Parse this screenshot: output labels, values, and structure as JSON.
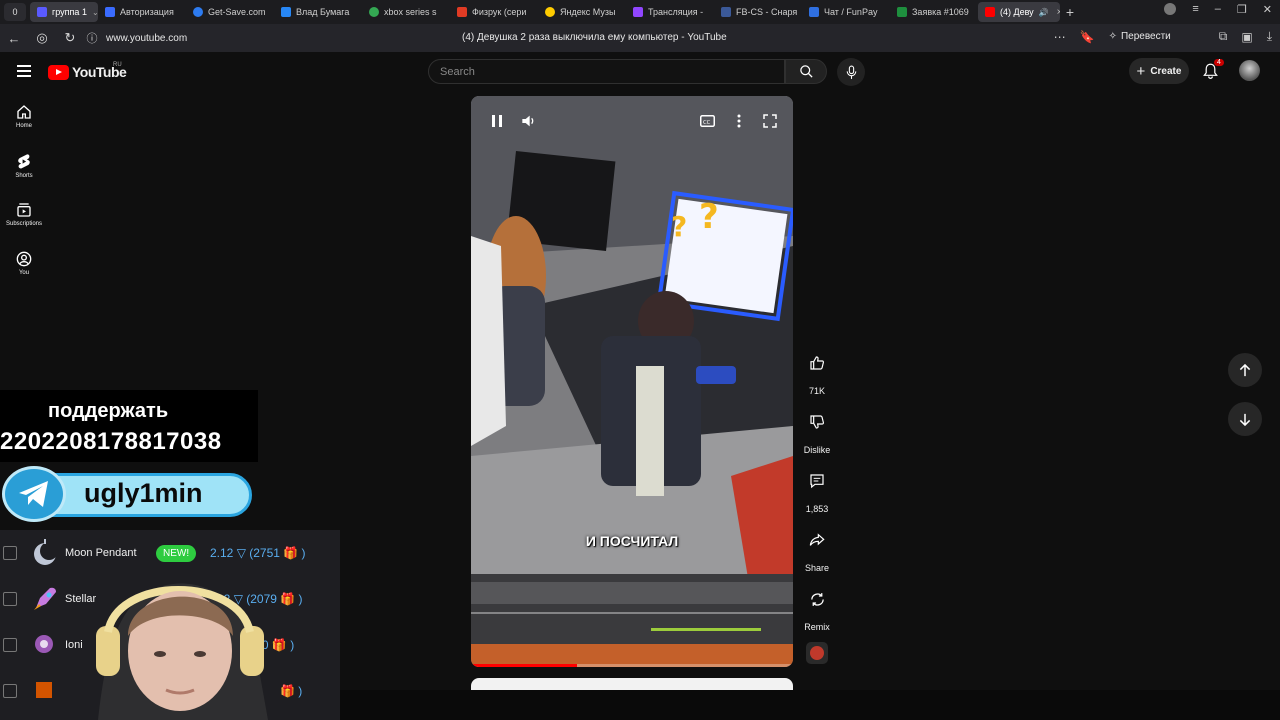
{
  "browser": {
    "tab_counter": "0",
    "tabs": [
      {
        "label": "группа 1",
        "color": "#5a5aff",
        "active": true
      },
      {
        "label": "Авторизация",
        "color": "#3a6bff"
      },
      {
        "label": "Get-Save.com",
        "color": "#2d7bf0"
      },
      {
        "label": "Влад Бумага",
        "color": "#2787f5"
      },
      {
        "label": "xbox series s",
        "color": "#34a853"
      },
      {
        "label": "Физрук (сери",
        "color": "#e03b24"
      },
      {
        "label": "Яндекс Музы",
        "color": "#ffcc00"
      },
      {
        "label": "Трансляция -",
        "color": "#9146ff"
      },
      {
        "label": "FB-CS - Снаря",
        "color": "#3b5998"
      },
      {
        "label": "Чат / FunPay",
        "color": "#2f6fe0"
      },
      {
        "label": "Заявка #1069",
        "color": "#1e8f3e"
      },
      {
        "label": "(4) Деву",
        "color": "#ff0000",
        "active": true
      }
    ],
    "url": "www.youtube.com",
    "page_title": "(4) Девушка 2 раза выключила ему компьютер - YouTube",
    "translate_label": "Перевести"
  },
  "header": {
    "logo_text": "YouTube",
    "country": "RU",
    "search_placeholder": "Search",
    "create_label": "Create",
    "notifications_count": "4"
  },
  "sidebar": {
    "items": [
      {
        "label": "Home",
        "icon": "home-icon"
      },
      {
        "label": "Shorts",
        "icon": "shorts-icon"
      },
      {
        "label": "Subscriptions",
        "icon": "subscriptions-icon"
      },
      {
        "label": "You",
        "icon": "you-icon"
      }
    ]
  },
  "player": {
    "subtitle": "И ПОСЧИТАЛ",
    "progress": 0.33
  },
  "actions": {
    "like_count": "71K",
    "dislike_label": "Dislike",
    "comments_count": "1,853",
    "share_label": "Share",
    "remix_label": "Remix"
  },
  "stream_overlay": {
    "donate_title": "поддержать",
    "card_number": "2202208178817038",
    "telegram": "ugly1min",
    "items": [
      {
        "name": "Moon Pendant",
        "badge": "NEW!",
        "price": "2.12 ▽ (2751 🎁 )"
      },
      {
        "name": "Stellar",
        "price": "2.12 ▽ (2079 🎁 )"
      },
      {
        "name": "Ioni",
        "price": "▽ (350 🎁 )"
      },
      {
        "name": "",
        "price": "🎁 )"
      }
    ]
  }
}
